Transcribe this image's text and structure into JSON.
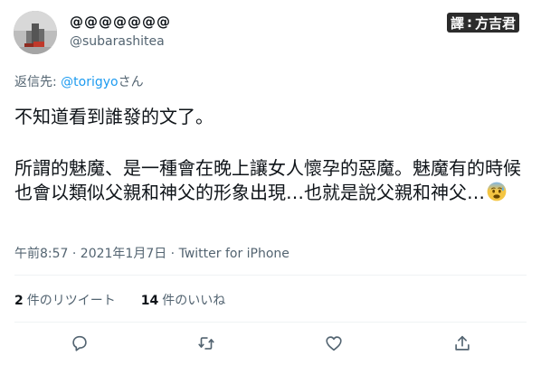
{
  "author": {
    "display_name": "@@@@@@@",
    "handle": "@subarashitea"
  },
  "translator_badge": {
    "prefix": "譯",
    "separator": ":",
    "name": "方吉君"
  },
  "reply_context": {
    "prefix": "返信先: ",
    "mention": "@torigyo",
    "suffix": "さん"
  },
  "tweet": {
    "line1": "不知道看到誰發的文了。",
    "line2": "所謂的魅魔、是一種會在晚上讓女人懷孕的惡魔。魅魔有的時候也會以類似父親和神父的形象出現…也就是說父親和神父…",
    "emoji_icon": "anxious-face-with-sweat"
  },
  "meta": {
    "timestamp": "午前8:57 · 2021年1月7日 · Twitter for iPhone"
  },
  "stats": {
    "retweets_count": "2",
    "retweets_label": "件のリツイート",
    "likes_count": "14",
    "likes_label": "件のいいね"
  },
  "actions": {
    "reply_icon": "speech-bubble-icon",
    "retweet_icon": "retweet-icon",
    "like_icon": "heart-icon",
    "share_icon": "share-icon"
  },
  "colors": {
    "accent": "#1d9bf0",
    "text_primary": "#0f1419",
    "text_secondary": "#536471",
    "divider": "#eff3f4"
  }
}
